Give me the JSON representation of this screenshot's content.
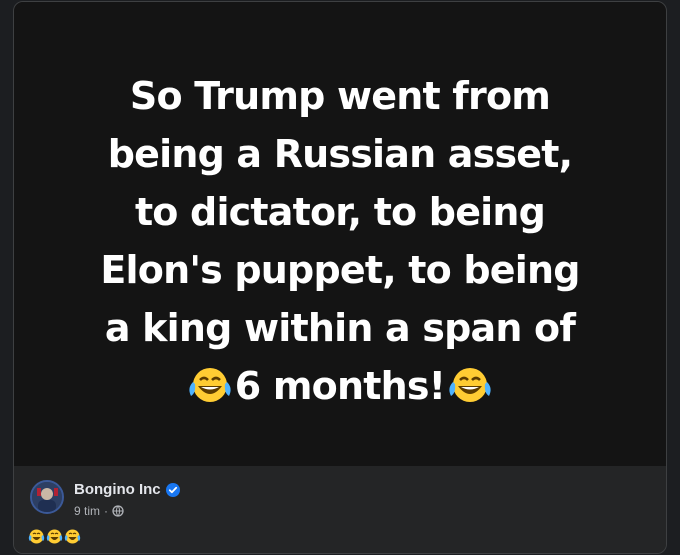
{
  "meme": {
    "line1": "So Trump went from",
    "line2": "being a Russian asset,",
    "line3": "to dictator, to being",
    "line4": "Elon's puppet, to being",
    "line5": "a king within a span of",
    "line6": "6 months!",
    "emoji": "laughing-crying-emoji"
  },
  "post": {
    "author": "Bongino Inc",
    "time": "9 tim",
    "separator": "·",
    "caption_emoji_count": 3
  },
  "colors": {
    "verified": "#1877f2",
    "emoji_yellow": "#ffcc33"
  }
}
